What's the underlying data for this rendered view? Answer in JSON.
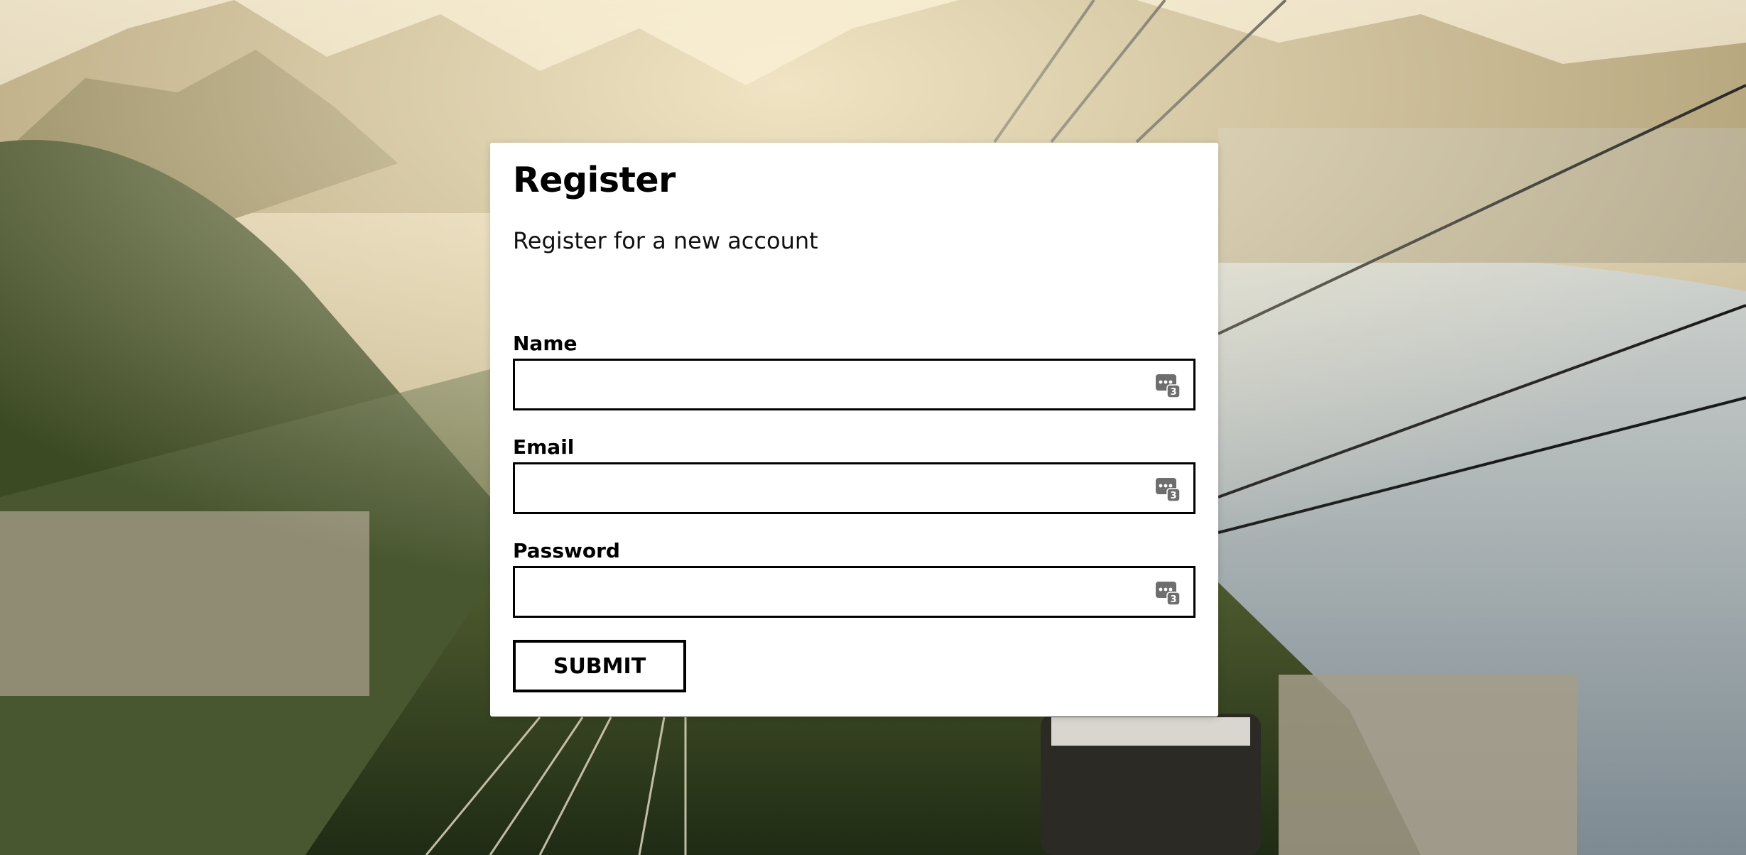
{
  "form": {
    "title": "Register",
    "subtitle": "Register for a new account",
    "fields": [
      {
        "label": "Name",
        "value": "",
        "placeholder": "",
        "icon": "password-manager-icon"
      },
      {
        "label": "Email",
        "value": "",
        "placeholder": "",
        "icon": "password-manager-icon"
      },
      {
        "label": "Password",
        "value": "",
        "placeholder": "",
        "icon": "password-manager-icon"
      }
    ],
    "submit_label": "SUBMIT"
  }
}
